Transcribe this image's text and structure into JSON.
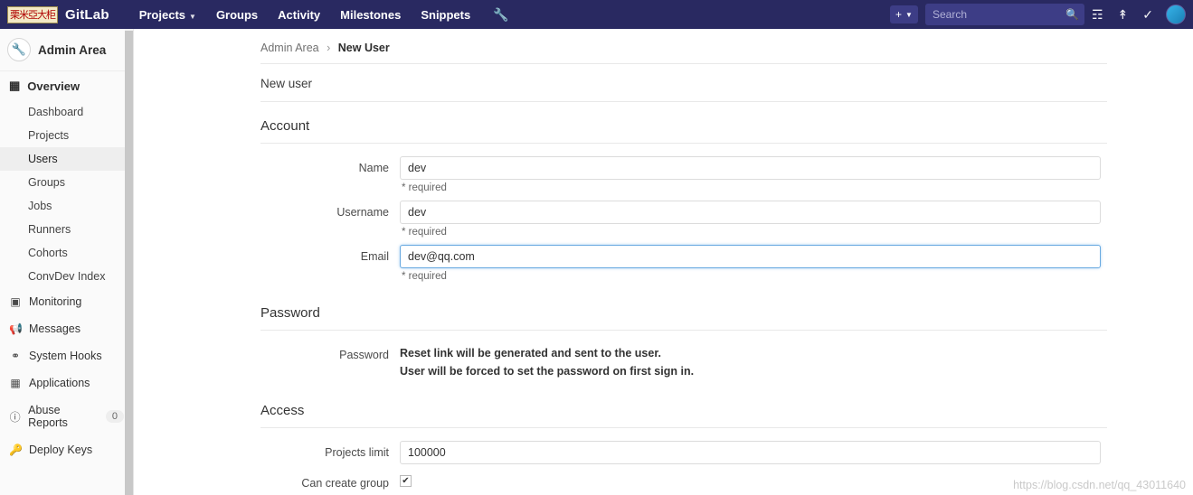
{
  "navbar": {
    "logo_text": "栗米亞大柜",
    "brand": "GitLab",
    "links": [
      {
        "label": "Projects",
        "caret": true
      },
      {
        "label": "Groups",
        "caret": false
      },
      {
        "label": "Activity",
        "caret": false
      },
      {
        "label": "Milestones",
        "caret": false
      },
      {
        "label": "Snippets",
        "caret": false
      }
    ],
    "wrench_icon": "wrench-icon",
    "plus_label": "+",
    "search_placeholder": "Search",
    "icons": [
      "issues-icon",
      "merge-requests-icon",
      "todos-icon"
    ]
  },
  "sidebar": {
    "header_title": "Admin Area",
    "header_icon": "wrench-icon",
    "overview": {
      "label": "Overview",
      "icon": "grid-icon",
      "items": [
        {
          "label": "Dashboard",
          "active": false
        },
        {
          "label": "Projects",
          "active": false
        },
        {
          "label": "Users",
          "active": true
        },
        {
          "label": "Groups",
          "active": false
        },
        {
          "label": "Jobs",
          "active": false
        },
        {
          "label": "Runners",
          "active": false
        },
        {
          "label": "Cohorts",
          "active": false
        },
        {
          "label": "ConvDev Index",
          "active": false
        }
      ]
    },
    "rows": [
      {
        "label": "Monitoring",
        "icon": "monitor-icon",
        "badge": ""
      },
      {
        "label": "Messages",
        "icon": "megaphone-icon",
        "badge": ""
      },
      {
        "label": "System Hooks",
        "icon": "hook-icon",
        "badge": ""
      },
      {
        "label": "Applications",
        "icon": "apps-icon",
        "badge": ""
      },
      {
        "label": "Abuse Reports",
        "icon": "flag-icon",
        "badge": "0"
      },
      {
        "label": "Deploy Keys",
        "icon": "key-icon",
        "badge": ""
      }
    ]
  },
  "main": {
    "breadcrumb": {
      "root": "Admin Area",
      "separator": "›",
      "current": "New User"
    },
    "page_title": "New user",
    "sections": {
      "account": {
        "title": "Account",
        "name": {
          "label": "Name",
          "value": "dev",
          "hint": "* required"
        },
        "username": {
          "label": "Username",
          "value": "dev",
          "hint": "* required"
        },
        "email": {
          "label": "Email",
          "value": "dev@qq.com",
          "hint": "* required"
        }
      },
      "password": {
        "title": "Password",
        "label": "Password",
        "line1": "Reset link will be generated and sent to the user.",
        "line2": "User will be forced to set the password on first sign in."
      },
      "access": {
        "title": "Access",
        "projects_limit": {
          "label": "Projects limit",
          "value": "100000"
        },
        "can_create_group": {
          "label": "Can create group",
          "checked": true
        }
      }
    },
    "watermark": "https://blog.csdn.net/qq_43011640"
  }
}
